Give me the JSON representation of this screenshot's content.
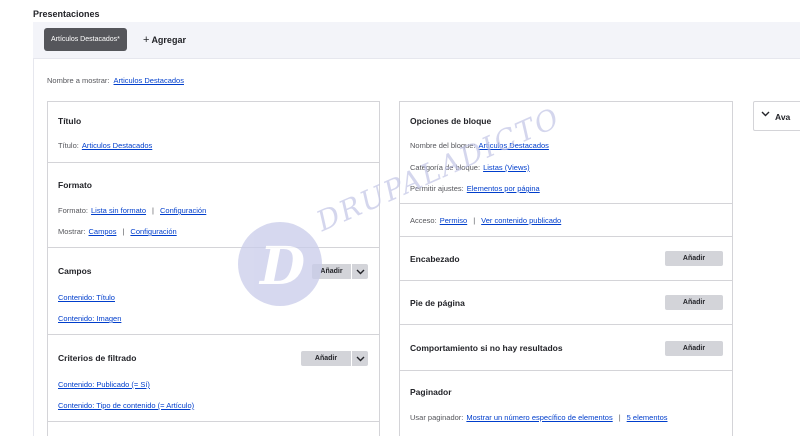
{
  "page": {
    "section_title": "Presentaciones",
    "display_tabs": [
      {
        "label": "Artículos Destacados*",
        "active": true
      }
    ],
    "add_display_label": "Agregar",
    "display_name_label": "Nombre a mostrar:",
    "display_name_value": "Articulos Destacados"
  },
  "left_column": {
    "title": {
      "heading": "Título",
      "label": "Título:",
      "value": "Articulos Destacados"
    },
    "format": {
      "heading": "Formato",
      "format_label": "Formato:",
      "format_value": "Lista sin formato",
      "format_settings": "Configuración",
      "show_label": "Mostrar:",
      "show_value": "Campos",
      "show_settings": "Configuración"
    },
    "fields": {
      "heading": "Campos",
      "add_label": "Añadir",
      "items": [
        "Contenido: Título",
        "Contenido: Imagen"
      ]
    },
    "filters": {
      "heading": "Criterios de filtrado",
      "add_label": "Añadir",
      "items": [
        "Contenido: Publicado (= Sí)",
        "Contenido: Tipo de contenido (= Artículo)"
      ]
    }
  },
  "middle_column": {
    "block": {
      "heading": "Opciones de bloque",
      "name_label": "Nombre del bloque:",
      "name_value": "Articulos Destacados",
      "category_label": "Categoría de bloque:",
      "category_value": "Listas (Views)",
      "allow_label": "Permitir ajustes:",
      "allow_value": "Elementos por página",
      "access_label": "Acceso:",
      "access_value": "Permiso",
      "access_extra": "Ver contenido publicado"
    },
    "header": {
      "heading": "Encabezado",
      "add_label": "Añadir"
    },
    "footer": {
      "heading": "Pie de página",
      "add_label": "Añadir"
    },
    "no_results": {
      "heading": "Comportamiento si no hay resultados",
      "add_label": "Añadir"
    },
    "pager": {
      "heading": "Paginador",
      "use_label": "Usar paginador:",
      "use_value": "Mostrar un número específico de elementos",
      "count_value": "5 elementos"
    }
  },
  "advanced": {
    "label": "Avanzado",
    "visible_label": "Ava"
  },
  "watermark": {
    "text": "DRUPALADICTO",
    "glyph": "D"
  },
  "colors": {
    "link": "#003ecc",
    "tab_active": "#55565b",
    "button": "#d3d4d9",
    "bar": "#f3f4f9"
  }
}
